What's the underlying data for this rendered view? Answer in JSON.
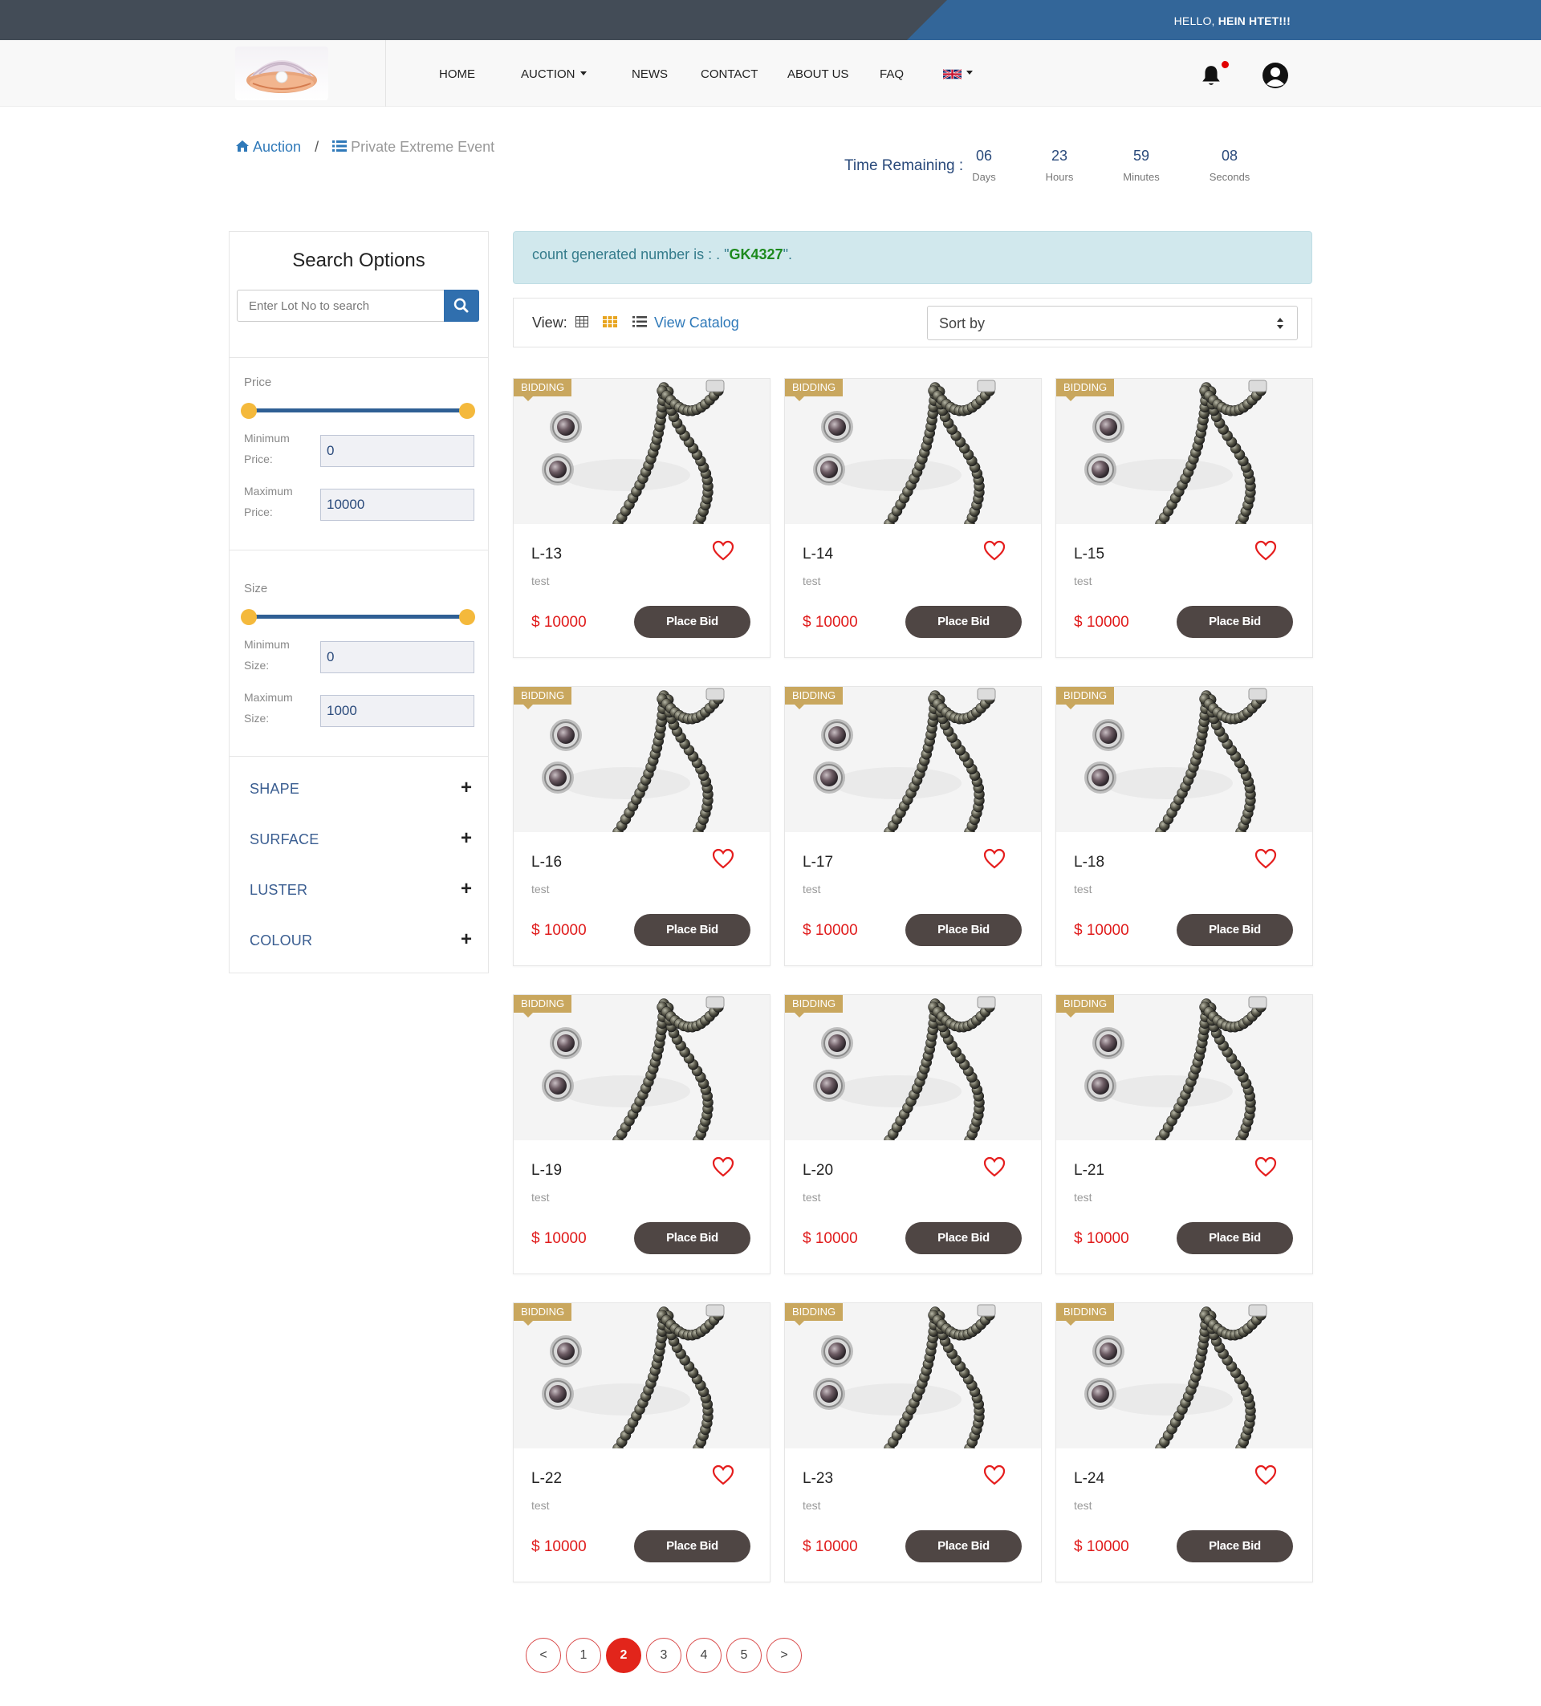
{
  "header": {
    "greeting_prefix": "HELLO,",
    "greeting_name": "HEIN HTET!!!"
  },
  "nav": {
    "items": [
      {
        "label": "HOME"
      },
      {
        "label": "AUCTION"
      },
      {
        "label": "NEWS"
      },
      {
        "label": "CONTACT"
      },
      {
        "label": "ABOUT US"
      },
      {
        "label": "FAQ"
      }
    ],
    "language_icon": "uk-flag-icon"
  },
  "breadcrumb": {
    "root": "Auction",
    "sep": "/",
    "current": "Private Extreme Event"
  },
  "timer": {
    "label": "Time Remaining :",
    "days": "06",
    "days_unit": "Days",
    "hours": "23",
    "hours_unit": "Hours",
    "minutes": "59",
    "minutes_unit": "Minutes",
    "seconds": "08",
    "seconds_unit": "Seconds"
  },
  "sidebar": {
    "title": "Search Options",
    "search_placeholder": "Enter Lot No to search",
    "price_label": "Price",
    "price_min_label": "Minimum Price:",
    "price_max_label": "Maximum Price:",
    "price_min": "0",
    "price_max": "10000",
    "size_label": "Size",
    "size_min_label": "Minimum Size:",
    "size_max_label": "Maximum Size:",
    "size_min": "0",
    "size_max": "1000",
    "filters": [
      {
        "label": "SHAPE"
      },
      {
        "label": "SURFACE"
      },
      {
        "label": "LUSTER"
      },
      {
        "label": "COLOUR"
      }
    ],
    "expand_symbol": "+"
  },
  "alert": {
    "prefix": "count generated number is : . \"",
    "code": "GK4327",
    "suffix": "\"."
  },
  "viewbar": {
    "view_label": "View:",
    "catalog_label": "View Catalog",
    "sort_label": "Sort by"
  },
  "products": [
    {
      "lot": "L-13",
      "desc": "test",
      "price": "$ 10000",
      "badge": "BIDDING",
      "button": "Place Bid"
    },
    {
      "lot": "L-14",
      "desc": "test",
      "price": "$ 10000",
      "badge": "BIDDING",
      "button": "Place Bid"
    },
    {
      "lot": "L-15",
      "desc": "test",
      "price": "$ 10000",
      "badge": "BIDDING",
      "button": "Place Bid"
    },
    {
      "lot": "L-16",
      "desc": "test",
      "price": "$ 10000",
      "badge": "BIDDING",
      "button": "Place Bid"
    },
    {
      "lot": "L-17",
      "desc": "test",
      "price": "$ 10000",
      "badge": "BIDDING",
      "button": "Place Bid"
    },
    {
      "lot": "L-18",
      "desc": "test",
      "price": "$ 10000",
      "badge": "BIDDING",
      "button": "Place Bid"
    },
    {
      "lot": "L-19",
      "desc": "test",
      "price": "$ 10000",
      "badge": "BIDDING",
      "button": "Place Bid"
    },
    {
      "lot": "L-20",
      "desc": "test",
      "price": "$ 10000",
      "badge": "BIDDING",
      "button": "Place Bid"
    },
    {
      "lot": "L-21",
      "desc": "test",
      "price": "$ 10000",
      "badge": "BIDDING",
      "button": "Place Bid"
    },
    {
      "lot": "L-22",
      "desc": "test",
      "price": "$ 10000",
      "badge": "BIDDING",
      "button": "Place Bid"
    },
    {
      "lot": "L-23",
      "desc": "test",
      "price": "$ 10000",
      "badge": "BIDDING",
      "button": "Place Bid"
    },
    {
      "lot": "L-24",
      "desc": "test",
      "price": "$ 10000",
      "badge": "BIDDING",
      "button": "Place Bid"
    }
  ],
  "pagination": {
    "pages": [
      "<",
      "1",
      "2",
      "3",
      "4",
      "5",
      ">"
    ],
    "active": "2"
  },
  "colors": {
    "topbar": "#434c57",
    "topbar_accent": "#336699",
    "price": "#e01b1b",
    "badge": "#c9a75e",
    "button": "#4f4644",
    "slider_thumb": "#f4b93c",
    "active_page": "#e2251b"
  }
}
